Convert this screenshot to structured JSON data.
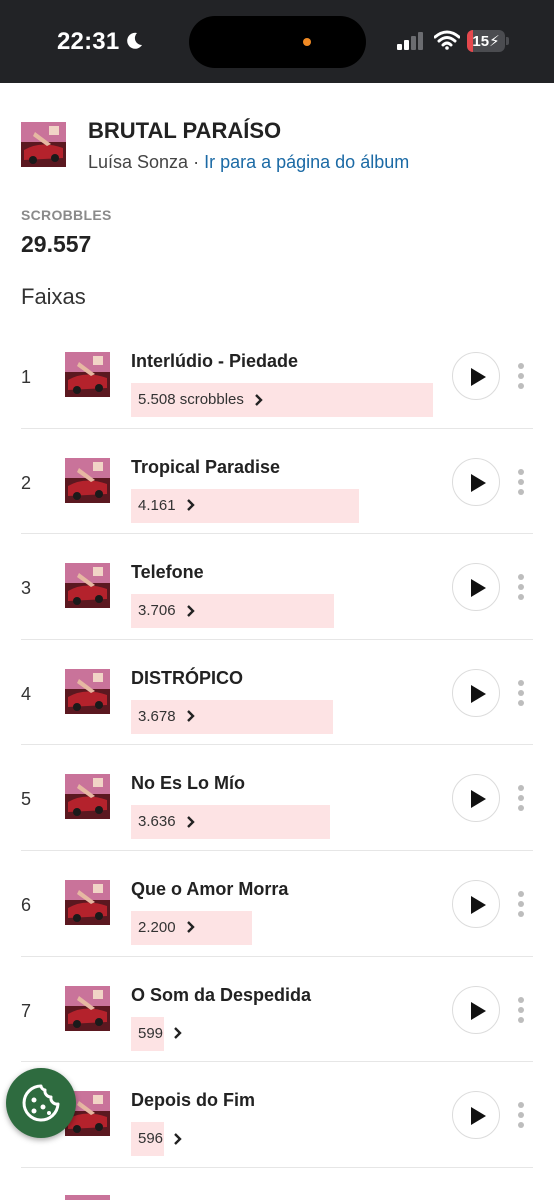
{
  "status_bar": {
    "time": "22:31",
    "battery_level": "15",
    "battery_fraction": 0.15,
    "icons": [
      "moon-icon",
      "signal-icon",
      "wifi-icon",
      "battery-charging-icon"
    ]
  },
  "album": {
    "title": "BRUTAL PARAÍSO",
    "artist": "Luísa Sonza",
    "separator": " · ",
    "link_label": "Ir para a página do álbum"
  },
  "scrobbles": {
    "label": "SCROBBLES",
    "value": "29.557"
  },
  "tracks_section": {
    "title": "Faixas"
  },
  "tracks": [
    {
      "number": "1",
      "name": "Interlúdio - Piedade",
      "count_label": "5.508 scrobbles",
      "scrobbles": 5508
    },
    {
      "number": "2",
      "name": "Tropical Paradise",
      "count_label": "4.161",
      "scrobbles": 4161
    },
    {
      "number": "3",
      "name": "Telefone",
      "count_label": "3.706",
      "scrobbles": 3706
    },
    {
      "number": "4",
      "name": "DISTRÓPICO",
      "count_label": "3.678",
      "scrobbles": 3678
    },
    {
      "number": "5",
      "name": "No Es Lo Mío",
      "count_label": "3.636",
      "scrobbles": 3636
    },
    {
      "number": "6",
      "name": "Que o Amor Morra",
      "count_label": "2.200",
      "scrobbles": 2200
    },
    {
      "number": "7",
      "name": "O Som da Despedida",
      "count_label": "599",
      "scrobbles": 599
    },
    {
      "number": "8",
      "name": "Depois do Fim",
      "count_label": "596",
      "scrobbles": 596
    }
  ],
  "colors": {
    "status_bar_bg": "#222326",
    "link": "#1b6aa5",
    "bar_fill": "#fde3e4",
    "cookie_button": "#2e6b3f"
  }
}
